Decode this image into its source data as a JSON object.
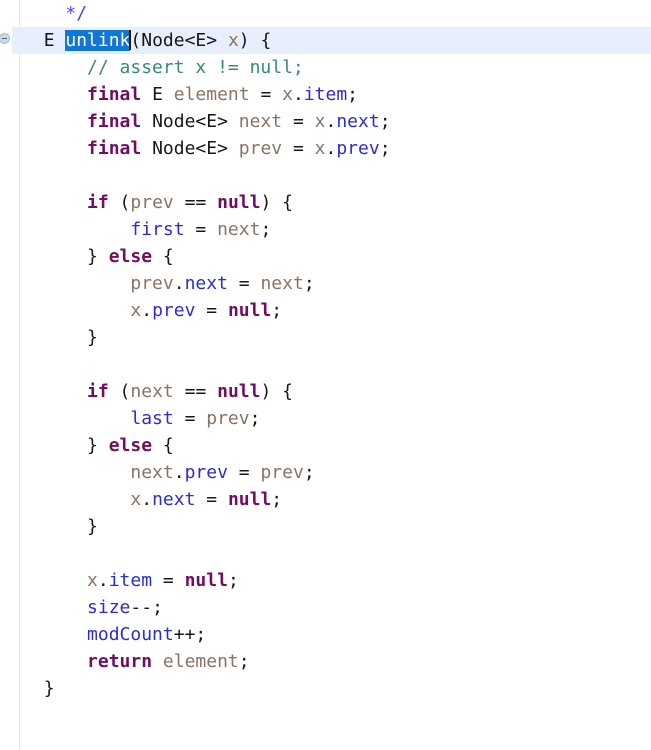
{
  "editor": {
    "language": "java",
    "font_size_px": 18,
    "line_height_px": 27,
    "colors": {
      "background": "#ffffff",
      "current_line_highlight": "#e7eefc",
      "selection_background": "#1177d6",
      "selection_text": "#ffffff",
      "keyword": "#720e62",
      "line_comment": "#38897a",
      "javadoc": "#4848e6",
      "field": "#2c2ccf",
      "local_variable": "#8a7363",
      "plain_text": "#171717",
      "gutter_separator": "#e8e8e8",
      "caret": "#111111"
    },
    "gutter": {
      "fold_icon": "fold-collapse-icon",
      "fold_icon_line_index": 1
    },
    "selection": {
      "text": "unlink",
      "line_index": 1
    },
    "caret": {
      "line_index": 1,
      "after_text": "unlink"
    },
    "lines": [
      {
        "index": 0,
        "current": false,
        "tokens": [
          {
            "t": "    ",
            "c": "plain"
          },
          {
            "t": "*/",
            "c": "doc"
          }
        ]
      },
      {
        "index": 1,
        "current": true,
        "tokens": [
          {
            "t": "  ",
            "c": "plain"
          },
          {
            "t": "E",
            "c": "typ"
          },
          {
            "t": " ",
            "c": "plain"
          },
          {
            "t": "unlink",
            "c": "sel"
          },
          {
            "t": "CARET",
            "c": "caret"
          },
          {
            "t": "(",
            "c": "punct"
          },
          {
            "t": "Node<E>",
            "c": "typ"
          },
          {
            "t": " ",
            "c": "plain"
          },
          {
            "t": "x",
            "c": "var"
          },
          {
            "t": ") {",
            "c": "punct"
          }
        ]
      },
      {
        "index": 2,
        "current": false,
        "tokens": [
          {
            "t": "      ",
            "c": "plain"
          },
          {
            "t": "// assert x != null;",
            "c": "cmt"
          }
        ]
      },
      {
        "index": 3,
        "current": false,
        "tokens": [
          {
            "t": "      ",
            "c": "plain"
          },
          {
            "t": "final",
            "c": "kw"
          },
          {
            "t": " ",
            "c": "plain"
          },
          {
            "t": "E",
            "c": "typ"
          },
          {
            "t": " ",
            "c": "plain"
          },
          {
            "t": "element",
            "c": "var"
          },
          {
            "t": " = ",
            "c": "punct"
          },
          {
            "t": "x",
            "c": "var"
          },
          {
            "t": ".",
            "c": "punct"
          },
          {
            "t": "item",
            "c": "fld"
          },
          {
            "t": ";",
            "c": "punct"
          }
        ]
      },
      {
        "index": 4,
        "current": false,
        "tokens": [
          {
            "t": "      ",
            "c": "plain"
          },
          {
            "t": "final",
            "c": "kw"
          },
          {
            "t": " ",
            "c": "plain"
          },
          {
            "t": "Node<E>",
            "c": "typ"
          },
          {
            "t": " ",
            "c": "plain"
          },
          {
            "t": "next",
            "c": "var"
          },
          {
            "t": " = ",
            "c": "punct"
          },
          {
            "t": "x",
            "c": "var"
          },
          {
            "t": ".",
            "c": "punct"
          },
          {
            "t": "next",
            "c": "fld"
          },
          {
            "t": ";",
            "c": "punct"
          }
        ]
      },
      {
        "index": 5,
        "current": false,
        "tokens": [
          {
            "t": "      ",
            "c": "plain"
          },
          {
            "t": "final",
            "c": "kw"
          },
          {
            "t": " ",
            "c": "plain"
          },
          {
            "t": "Node<E>",
            "c": "typ"
          },
          {
            "t": " ",
            "c": "plain"
          },
          {
            "t": "prev",
            "c": "var"
          },
          {
            "t": " = ",
            "c": "punct"
          },
          {
            "t": "x",
            "c": "var"
          },
          {
            "t": ".",
            "c": "punct"
          },
          {
            "t": "prev",
            "c": "fld"
          },
          {
            "t": ";",
            "c": "punct"
          }
        ]
      },
      {
        "index": 6,
        "current": false,
        "tokens": []
      },
      {
        "index": 7,
        "current": false,
        "tokens": [
          {
            "t": "      ",
            "c": "plain"
          },
          {
            "t": "if",
            "c": "kw"
          },
          {
            "t": " (",
            "c": "punct"
          },
          {
            "t": "prev",
            "c": "var"
          },
          {
            "t": " == ",
            "c": "punct"
          },
          {
            "t": "null",
            "c": "kw"
          },
          {
            "t": ") {",
            "c": "punct"
          }
        ]
      },
      {
        "index": 8,
        "current": false,
        "tokens": [
          {
            "t": "          ",
            "c": "plain"
          },
          {
            "t": "first",
            "c": "fld"
          },
          {
            "t": " = ",
            "c": "punct"
          },
          {
            "t": "next",
            "c": "var"
          },
          {
            "t": ";",
            "c": "punct"
          }
        ]
      },
      {
        "index": 9,
        "current": false,
        "tokens": [
          {
            "t": "      ",
            "c": "plain"
          },
          {
            "t": "}",
            "c": "punct"
          },
          {
            "t": " ",
            "c": "plain"
          },
          {
            "t": "else",
            "c": "kw"
          },
          {
            "t": " {",
            "c": "punct"
          }
        ]
      },
      {
        "index": 10,
        "current": false,
        "tokens": [
          {
            "t": "          ",
            "c": "plain"
          },
          {
            "t": "prev",
            "c": "var"
          },
          {
            "t": ".",
            "c": "punct"
          },
          {
            "t": "next",
            "c": "fld"
          },
          {
            "t": " = ",
            "c": "punct"
          },
          {
            "t": "next",
            "c": "var"
          },
          {
            "t": ";",
            "c": "punct"
          }
        ]
      },
      {
        "index": 11,
        "current": false,
        "tokens": [
          {
            "t": "          ",
            "c": "plain"
          },
          {
            "t": "x",
            "c": "var"
          },
          {
            "t": ".",
            "c": "punct"
          },
          {
            "t": "prev",
            "c": "fld"
          },
          {
            "t": " = ",
            "c": "punct"
          },
          {
            "t": "null",
            "c": "kw"
          },
          {
            "t": ";",
            "c": "punct"
          }
        ]
      },
      {
        "index": 12,
        "current": false,
        "tokens": [
          {
            "t": "      ",
            "c": "plain"
          },
          {
            "t": "}",
            "c": "punct"
          }
        ]
      },
      {
        "index": 13,
        "current": false,
        "tokens": []
      },
      {
        "index": 14,
        "current": false,
        "tokens": [
          {
            "t": "      ",
            "c": "plain"
          },
          {
            "t": "if",
            "c": "kw"
          },
          {
            "t": " (",
            "c": "punct"
          },
          {
            "t": "next",
            "c": "var"
          },
          {
            "t": " == ",
            "c": "punct"
          },
          {
            "t": "null",
            "c": "kw"
          },
          {
            "t": ") {",
            "c": "punct"
          }
        ]
      },
      {
        "index": 15,
        "current": false,
        "tokens": [
          {
            "t": "          ",
            "c": "plain"
          },
          {
            "t": "last",
            "c": "fld"
          },
          {
            "t": " = ",
            "c": "punct"
          },
          {
            "t": "prev",
            "c": "var"
          },
          {
            "t": ";",
            "c": "punct"
          }
        ]
      },
      {
        "index": 16,
        "current": false,
        "tokens": [
          {
            "t": "      ",
            "c": "plain"
          },
          {
            "t": "}",
            "c": "punct"
          },
          {
            "t": " ",
            "c": "plain"
          },
          {
            "t": "else",
            "c": "kw"
          },
          {
            "t": " {",
            "c": "punct"
          }
        ]
      },
      {
        "index": 17,
        "current": false,
        "tokens": [
          {
            "t": "          ",
            "c": "plain"
          },
          {
            "t": "next",
            "c": "var"
          },
          {
            "t": ".",
            "c": "punct"
          },
          {
            "t": "prev",
            "c": "fld"
          },
          {
            "t": " = ",
            "c": "punct"
          },
          {
            "t": "prev",
            "c": "var"
          },
          {
            "t": ";",
            "c": "punct"
          }
        ]
      },
      {
        "index": 18,
        "current": false,
        "tokens": [
          {
            "t": "          ",
            "c": "plain"
          },
          {
            "t": "x",
            "c": "var"
          },
          {
            "t": ".",
            "c": "punct"
          },
          {
            "t": "next",
            "c": "fld"
          },
          {
            "t": " = ",
            "c": "punct"
          },
          {
            "t": "null",
            "c": "kw"
          },
          {
            "t": ";",
            "c": "punct"
          }
        ]
      },
      {
        "index": 19,
        "current": false,
        "tokens": [
          {
            "t": "      ",
            "c": "plain"
          },
          {
            "t": "}",
            "c": "punct"
          }
        ]
      },
      {
        "index": 20,
        "current": false,
        "tokens": []
      },
      {
        "index": 21,
        "current": false,
        "tokens": [
          {
            "t": "      ",
            "c": "plain"
          },
          {
            "t": "x",
            "c": "var"
          },
          {
            "t": ".",
            "c": "punct"
          },
          {
            "t": "item",
            "c": "fld"
          },
          {
            "t": " = ",
            "c": "punct"
          },
          {
            "t": "null",
            "c": "kw"
          },
          {
            "t": ";",
            "c": "punct"
          }
        ]
      },
      {
        "index": 22,
        "current": false,
        "tokens": [
          {
            "t": "      ",
            "c": "plain"
          },
          {
            "t": "size",
            "c": "fld"
          },
          {
            "t": "--;",
            "c": "punct"
          }
        ]
      },
      {
        "index": 23,
        "current": false,
        "tokens": [
          {
            "t": "      ",
            "c": "plain"
          },
          {
            "t": "modCount",
            "c": "fld"
          },
          {
            "t": "++;",
            "c": "punct"
          }
        ]
      },
      {
        "index": 24,
        "current": false,
        "tokens": [
          {
            "t": "      ",
            "c": "plain"
          },
          {
            "t": "return",
            "c": "kw"
          },
          {
            "t": " ",
            "c": "plain"
          },
          {
            "t": "element",
            "c": "var"
          },
          {
            "t": ";",
            "c": "punct"
          }
        ]
      },
      {
        "index": 25,
        "current": false,
        "tokens": [
          {
            "t": "  ",
            "c": "plain"
          },
          {
            "t": "}",
            "c": "punct"
          }
        ]
      }
    ]
  }
}
